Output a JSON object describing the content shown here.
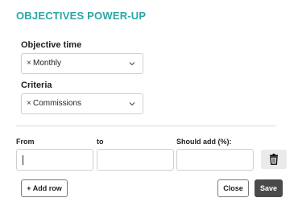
{
  "dialog": {
    "title": "OBJECTIVES POWER-UP"
  },
  "objective_time": {
    "label": "Objective time",
    "remove_glyph": "×",
    "value": "Monthly"
  },
  "criteria": {
    "label": "Criteria",
    "remove_glyph": "×",
    "value": "Commissions"
  },
  "columns": {
    "from": "From",
    "to": "to",
    "should_add": "Should add (%):"
  },
  "row": {
    "from_value": "",
    "to_value": "",
    "should_add_value": ""
  },
  "actions": {
    "add_row": "+ Add row",
    "close": "Close",
    "save": "Save"
  },
  "colors": {
    "title": "#2aa6a8",
    "save_bg": "#4a4a4a"
  }
}
